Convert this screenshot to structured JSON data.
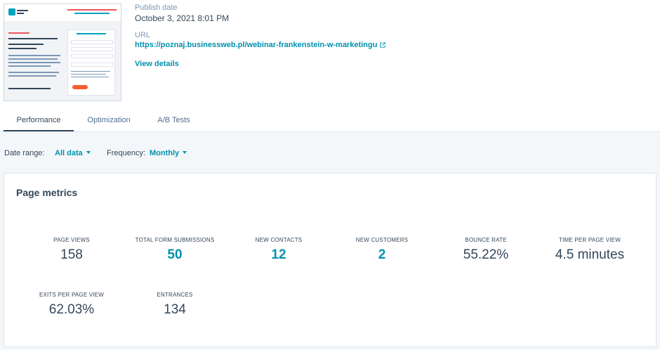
{
  "page_meta": {
    "publish_date_label": "Publish date",
    "publish_date_value": "October 3, 2021 8:01 PM",
    "url_label": "URL",
    "url_value": "https://poznaj.businessweb.pl/webinar-frankenstein-w-marketingu",
    "view_details": "View details",
    "external_link_icon": "external-link-icon"
  },
  "tabs": [
    {
      "label": "Performance",
      "active": true
    },
    {
      "label": "Optimization",
      "active": false
    },
    {
      "label": "A/B Tests",
      "active": false
    }
  ],
  "filters": {
    "date_range_label": "Date range:",
    "date_range_value": "All data",
    "frequency_label": "Frequency:",
    "frequency_value": "Monthly"
  },
  "metrics": {
    "title": "Page metrics",
    "items": [
      {
        "label": "PAGE VIEWS",
        "value": "158",
        "link": false
      },
      {
        "label": "TOTAL FORM SUBMISSIONS",
        "value": "50",
        "link": true
      },
      {
        "label": "NEW CONTACTS",
        "value": "12",
        "link": true
      },
      {
        "label": "NEW CUSTOMERS",
        "value": "2",
        "link": true
      },
      {
        "label": "BOUNCE RATE",
        "value": "55.22%",
        "link": false
      },
      {
        "label": "TIME PER PAGE VIEW",
        "value": "4.5 minutes",
        "link": false
      },
      {
        "label": "EXITS PER PAGE VIEW",
        "value": "62.03%",
        "link": false
      },
      {
        "label": "ENTRANCES",
        "value": "134",
        "link": false
      }
    ]
  },
  "colors": {
    "accent": "#0091ae",
    "text": "#33475b",
    "muted": "#7c98b6",
    "background": "#f4f7fa"
  }
}
